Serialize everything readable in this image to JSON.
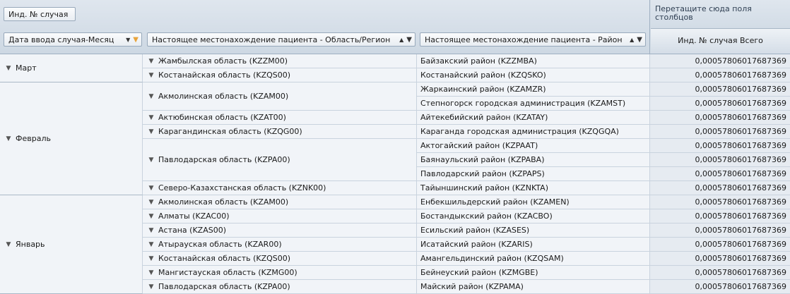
{
  "toolbar": {
    "case_id_button": "Инд. № случая"
  },
  "drop_zone_text": "Перетащите сюда поля столбцов",
  "row_fields": [
    {
      "label": "Дата ввода случая-Месяц",
      "sort": "▼",
      "filter": "▼",
      "filter_active": true
    },
    {
      "label": "Настоящее местонахождение пациента - Область/Регион",
      "sort": "▲",
      "filter": "▼",
      "filter_active": false
    },
    {
      "label": "Настоящее местонахождение пациента - Район",
      "sort": "▲",
      "filter": "▼",
      "filter_active": false
    }
  ],
  "measure_header": "Инд. № случая Всего",
  "icons": {
    "expand": "chevron-down-icon",
    "sort": "sort-triangle-icon",
    "filter": "funnel-icon"
  },
  "colors": {
    "accent_filter": "#e8a33a",
    "header_bg": "#d6dfe8",
    "value_bg": "#e6ebf1"
  },
  "groups": [
    {
      "month": "Март",
      "regions": [
        {
          "name": "Жамбылская область (KZZM00)",
          "districts": [
            {
              "name": "Байзакский район (KZZMBA)",
              "value": "0,00057806017687369"
            }
          ]
        },
        {
          "name": "Костанайская область (KZQS00)",
          "districts": [
            {
              "name": "Костанайский район (KZQSKO)",
              "value": "0,00057806017687369"
            }
          ]
        }
      ]
    },
    {
      "month": "Февраль",
      "regions": [
        {
          "name": "Акмолинская область (KZAM00)",
          "districts": [
            {
              "name": "Жаркаинский район (KZAMZR)",
              "value": "0,00057806017687369"
            },
            {
              "name": "Степногорск городская администрация (KZAMST)",
              "value": "0,00057806017687369"
            }
          ]
        },
        {
          "name": "Актюбинская область (KZAT00)",
          "districts": [
            {
              "name": "Айтекебийский район (KZATAY)",
              "value": "0,00057806017687369"
            }
          ]
        },
        {
          "name": "Карагандинская область (KZQG00)",
          "districts": [
            {
              "name": "Караганда городская администрация (KZQGQA)",
              "value": "0,00057806017687369"
            }
          ]
        },
        {
          "name": "Павлодарская область (KZPA00)",
          "districts": [
            {
              "name": "Актогайский район (KZPAAT)",
              "value": "0,00057806017687369"
            },
            {
              "name": "Баянаульский район (KZPABA)",
              "value": "0,00057806017687369"
            },
            {
              "name": "Павлодарский район (KZPAPS)",
              "value": "0,00057806017687369"
            }
          ]
        },
        {
          "name": "Северо-Казахстанская область (KZNK00)",
          "districts": [
            {
              "name": "Тайыншинский район (KZNKTA)",
              "value": "0,00057806017687369"
            }
          ]
        }
      ]
    },
    {
      "month": "Январь",
      "regions": [
        {
          "name": "Акмолинская область (KZAM00)",
          "districts": [
            {
              "name": "Енбекшильдерский район (KZAMEN)",
              "value": "0,00057806017687369"
            }
          ]
        },
        {
          "name": "Алматы (KZAC00)",
          "districts": [
            {
              "name": "Бостандыкский район (KZACBO)",
              "value": "0,00057806017687369"
            }
          ]
        },
        {
          "name": "Астана (KZAS00)",
          "districts": [
            {
              "name": "Есильский район (KZASES)",
              "value": "0,00057806017687369"
            }
          ]
        },
        {
          "name": "Атырауская область (KZAR00)",
          "districts": [
            {
              "name": "Исатайский район (KZARIS)",
              "value": "0,00057806017687369"
            }
          ]
        },
        {
          "name": "Костанайская область (KZQS00)",
          "districts": [
            {
              "name": "Амангельдинский район (KZQSAM)",
              "value": "0,00057806017687369"
            }
          ]
        },
        {
          "name": "Мангистауская область (KZMG00)",
          "districts": [
            {
              "name": "Бейнеуский район (KZMGBE)",
              "value": "0,00057806017687369"
            }
          ]
        },
        {
          "name": "Павлодарская область (KZPA00)",
          "districts": [
            {
              "name": "Майский район (KZPAMA)",
              "value": "0,00057806017687369"
            }
          ]
        }
      ]
    }
  ]
}
